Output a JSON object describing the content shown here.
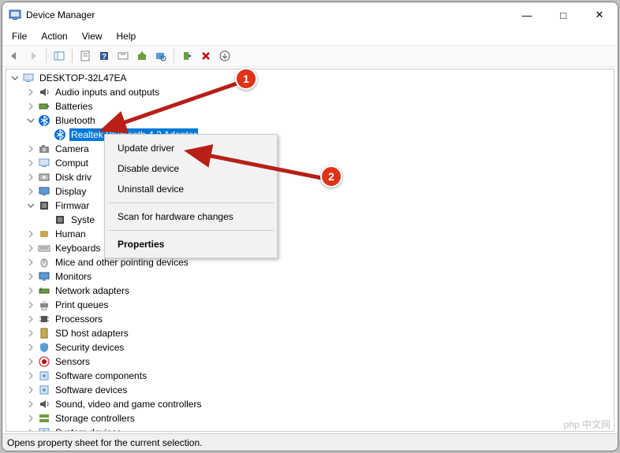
{
  "window": {
    "title": "Device Manager"
  },
  "menubar": [
    "File",
    "Action",
    "View",
    "Help"
  ],
  "win_controls": {
    "min": "—",
    "max": "□",
    "close": "✕"
  },
  "root": "DESKTOP-32L47EA",
  "context_menu": {
    "update": "Update driver",
    "disable": "Disable device",
    "uninstall": "Uninstall device",
    "scan": "Scan for hardware changes",
    "properties": "Properties"
  },
  "tree": [
    {
      "label": "Audio inputs and outputs",
      "indent": 1,
      "exp": "closed",
      "icon": "audio"
    },
    {
      "label": "Batteries",
      "indent": 1,
      "exp": "closed",
      "icon": "battery"
    },
    {
      "label": "Bluetooth",
      "indent": 1,
      "exp": "open",
      "icon": "bluetooth"
    },
    {
      "label": "Realtek Bluetooth 4.2 Adapter",
      "indent": 2,
      "exp": "none",
      "icon": "bluetooth",
      "selected": true
    },
    {
      "label": "Camera",
      "indent": 1,
      "exp": "closed",
      "icon": "camera"
    },
    {
      "label": "Comput",
      "indent": 1,
      "exp": "closed",
      "icon": "computer"
    },
    {
      "label": "Disk driv",
      "indent": 1,
      "exp": "closed",
      "icon": "disk"
    },
    {
      "label": "Display ",
      "indent": 1,
      "exp": "closed",
      "icon": "display"
    },
    {
      "label": "Firmwar",
      "indent": 1,
      "exp": "open",
      "icon": "firmware"
    },
    {
      "label": "Syste",
      "indent": 2,
      "exp": "none",
      "icon": "firmware"
    },
    {
      "label": "Human ",
      "indent": 1,
      "exp": "closed",
      "icon": "hid"
    },
    {
      "label": "Keyboards",
      "indent": 1,
      "exp": "closed",
      "icon": "keyboard"
    },
    {
      "label": "Mice and other pointing devices",
      "indent": 1,
      "exp": "closed",
      "icon": "mouse"
    },
    {
      "label": "Monitors",
      "indent": 1,
      "exp": "closed",
      "icon": "display"
    },
    {
      "label": "Network adapters",
      "indent": 1,
      "exp": "closed",
      "icon": "network"
    },
    {
      "label": "Print queues",
      "indent": 1,
      "exp": "closed",
      "icon": "printer"
    },
    {
      "label": "Processors",
      "indent": 1,
      "exp": "closed",
      "icon": "cpu"
    },
    {
      "label": "SD host adapters",
      "indent": 1,
      "exp": "closed",
      "icon": "sd"
    },
    {
      "label": "Security devices",
      "indent": 1,
      "exp": "closed",
      "icon": "security"
    },
    {
      "label": "Sensors",
      "indent": 1,
      "exp": "closed",
      "icon": "sensor"
    },
    {
      "label": "Software components",
      "indent": 1,
      "exp": "closed",
      "icon": "component"
    },
    {
      "label": "Software devices",
      "indent": 1,
      "exp": "closed",
      "icon": "component"
    },
    {
      "label": "Sound, video and game controllers",
      "indent": 1,
      "exp": "closed",
      "icon": "audio"
    },
    {
      "label": "Storage controllers",
      "indent": 1,
      "exp": "closed",
      "icon": "storage"
    },
    {
      "label": "System devices",
      "indent": 1,
      "exp": "closed",
      "icon": "system"
    }
  ],
  "status": "Opens property sheet for the current selection.",
  "callouts": {
    "c1": "1",
    "c2": "2"
  },
  "watermark": "php 中文网"
}
